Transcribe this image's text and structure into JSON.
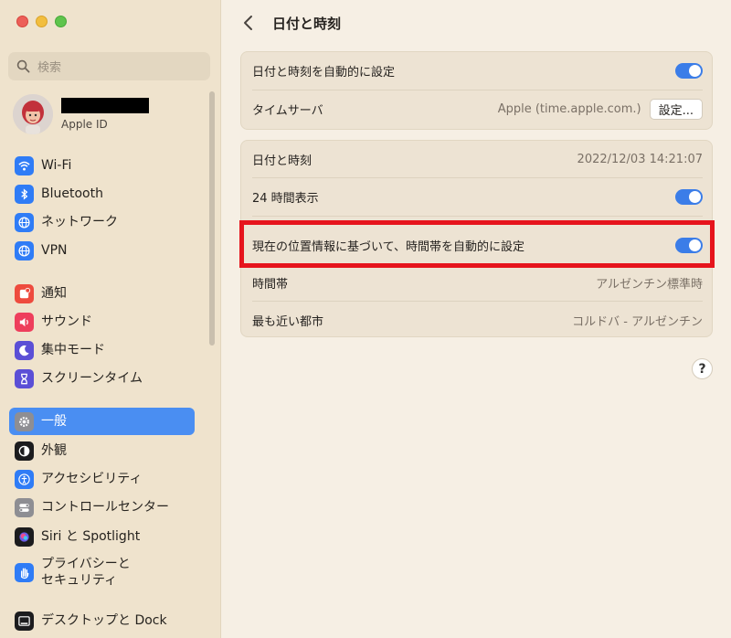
{
  "sidebar": {
    "search_placeholder": "検索",
    "account": {
      "subtitle": "Apple ID"
    },
    "items": [
      {
        "label": "Wi-Fi",
        "icon": "wifi-icon",
        "color": "#2f7cf6"
      },
      {
        "label": "Bluetooth",
        "icon": "bluetooth-icon",
        "color": "#2f7cf6"
      },
      {
        "label": "ネットワーク",
        "icon": "globe-icon",
        "color": "#2f7cf6"
      },
      {
        "label": "VPN",
        "icon": "vpn-globe-icon",
        "color": "#2f7cf6"
      },
      {
        "label": "通知",
        "icon": "bell-icon",
        "color": "#ee4b3e"
      },
      {
        "label": "サウンド",
        "icon": "speaker-icon",
        "color": "#ee3e5c"
      },
      {
        "label": "集中モード",
        "icon": "moon-icon",
        "color": "#5b4fd6"
      },
      {
        "label": "スクリーンタイム",
        "icon": "hourglass-icon",
        "color": "#5b4fd6"
      },
      {
        "label": "一般",
        "icon": "gear-icon",
        "color": "#8e8e93"
      },
      {
        "label": "外観",
        "icon": "appearance-icon",
        "color": "#1c1c1e"
      },
      {
        "label": "アクセシビリティ",
        "icon": "accessibility-icon",
        "color": "#2f7cf6"
      },
      {
        "label": "コントロールセンター",
        "icon": "switches-icon",
        "color": "#8e8e93"
      },
      {
        "label": "Siri と Spotlight",
        "icon": "siri-icon",
        "color": "#1c1c1e"
      },
      {
        "label": "プライバシーと\nセキュリティ",
        "icon": "hand-icon",
        "color": "#2f7cf6"
      },
      {
        "label": "デスクトップと Dock",
        "icon": "dock-icon",
        "color": "#1c1c1e"
      }
    ],
    "selected": "一般"
  },
  "main": {
    "title": "日付と時刻",
    "group1": {
      "auto_set_label": "日付と時刻を自動的に設定",
      "auto_set_on": true,
      "time_server_label": "タイムサーバ",
      "time_server_value": "Apple (time.apple.com.)",
      "set_button": "設定..."
    },
    "group2": {
      "datetime_label": "日付と時刻",
      "datetime_value": "2022/12/03 14:21:07",
      "h24_label": "24 時間表示",
      "h24_on": true,
      "auto_tz_label": "現在の位置情報に基づいて、時間帯を自動的に設定",
      "auto_tz_on": true,
      "tz_label": "時間帯",
      "tz_value": "アルゼンチン標準時",
      "city_label": "最も近い都市",
      "city_value": "コルドバ - アルゼンチン"
    },
    "help": "?",
    "highlight_color": "#e6141c"
  }
}
